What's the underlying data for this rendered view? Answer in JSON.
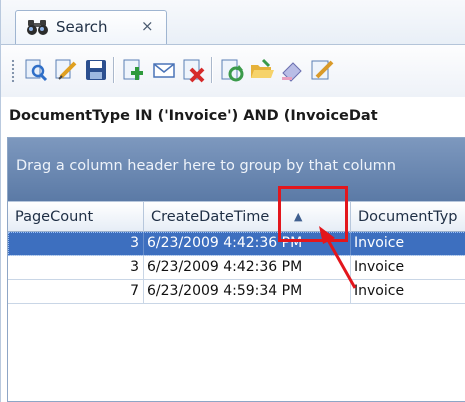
{
  "tab": {
    "label": "Search",
    "close_glyph": "×",
    "icon": "binoculars-icon"
  },
  "toolbar": {
    "buttons": [
      {
        "name": "search-icon",
        "color": "#2f6fc8"
      },
      {
        "name": "edit-query-icon",
        "color": "#e0a020"
      },
      {
        "name": "save-icon",
        "color": "#2b4f8f"
      },
      {
        "name": "add-document-icon",
        "color": "#2e9a3c"
      },
      {
        "name": "email-icon",
        "color": "#4a74b8"
      },
      {
        "name": "delete-icon",
        "color": "#d62a2a"
      },
      {
        "name": "refresh-icon",
        "color": "#3a9a4a"
      },
      {
        "name": "open-folder-icon",
        "color": "#e6b23a"
      },
      {
        "name": "eraser-icon",
        "color": "#8a8fc8"
      },
      {
        "name": "edit-icon",
        "color": "#d99a2a"
      }
    ]
  },
  "query": {
    "text": "DocumentType IN ('Invoice') AND (InvoiceDat"
  },
  "grid": {
    "group_panel_text": "Drag a column header here to group by that column",
    "columns": [
      {
        "label": "PageCount"
      },
      {
        "label": "CreateDateTime"
      },
      {
        "label": "DocumentTyp"
      }
    ],
    "sort_glyph": "▲",
    "rows": [
      {
        "page_count": "3",
        "create_date_time": "6/23/2009 4:42:36 PM",
        "document_type": "Invoice",
        "selected": true
      },
      {
        "page_count": "3",
        "create_date_time": "6/23/2009 4:42:36 PM",
        "document_type": "Invoice",
        "selected": false
      },
      {
        "page_count": "7",
        "create_date_time": "6/23/2009 4:59:34 PM",
        "document_type": "Invoice",
        "selected": false
      }
    ]
  },
  "colors": {
    "annotation_red": "#e3161c",
    "selection_blue": "#3d6fbf",
    "group_panel": "#6b88b2"
  }
}
